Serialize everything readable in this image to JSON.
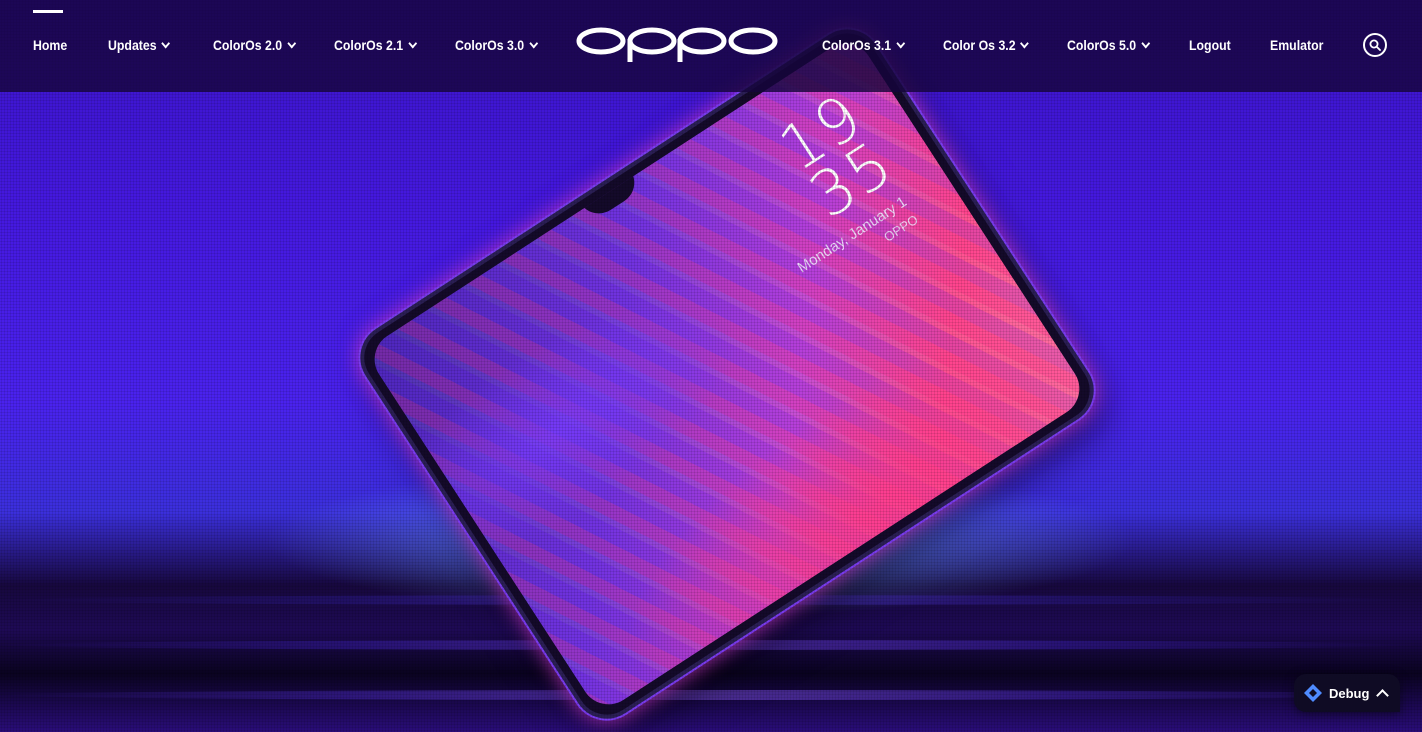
{
  "nav": {
    "items": [
      {
        "label": "Home",
        "active": true,
        "dropdown": false
      },
      {
        "label": "Updates",
        "dropdown": true
      },
      {
        "label": "ColorOs 2.0",
        "dropdown": true
      },
      {
        "label": "ColorOs 2.1",
        "dropdown": true
      },
      {
        "label": "ColorOs 3.0",
        "dropdown": true
      },
      {
        "label": "ColorOs 3.1",
        "dropdown": true
      },
      {
        "label": "Color Os 3.2",
        "dropdown": true
      },
      {
        "label": "ColorOs 5.0",
        "dropdown": true
      },
      {
        "label": "Logout",
        "dropdown": false
      },
      {
        "label": "Emulator",
        "dropdown": false
      }
    ],
    "search_icon": "search-icon"
  },
  "brand": {
    "logo_text": "oppo"
  },
  "hero": {
    "lock_time_hour": "19",
    "lock_time_minute": "35",
    "lock_date": "Monday, January 1",
    "lock_brand": "OPPO"
  },
  "debug": {
    "label": "Debug",
    "icon": "diamond-icon",
    "toggle_icon": "chevron-up-icon"
  },
  "colors": {
    "nav_bg": "#16053c",
    "accent": "#4a22ee",
    "debug_diamond": "#4f8bff"
  }
}
